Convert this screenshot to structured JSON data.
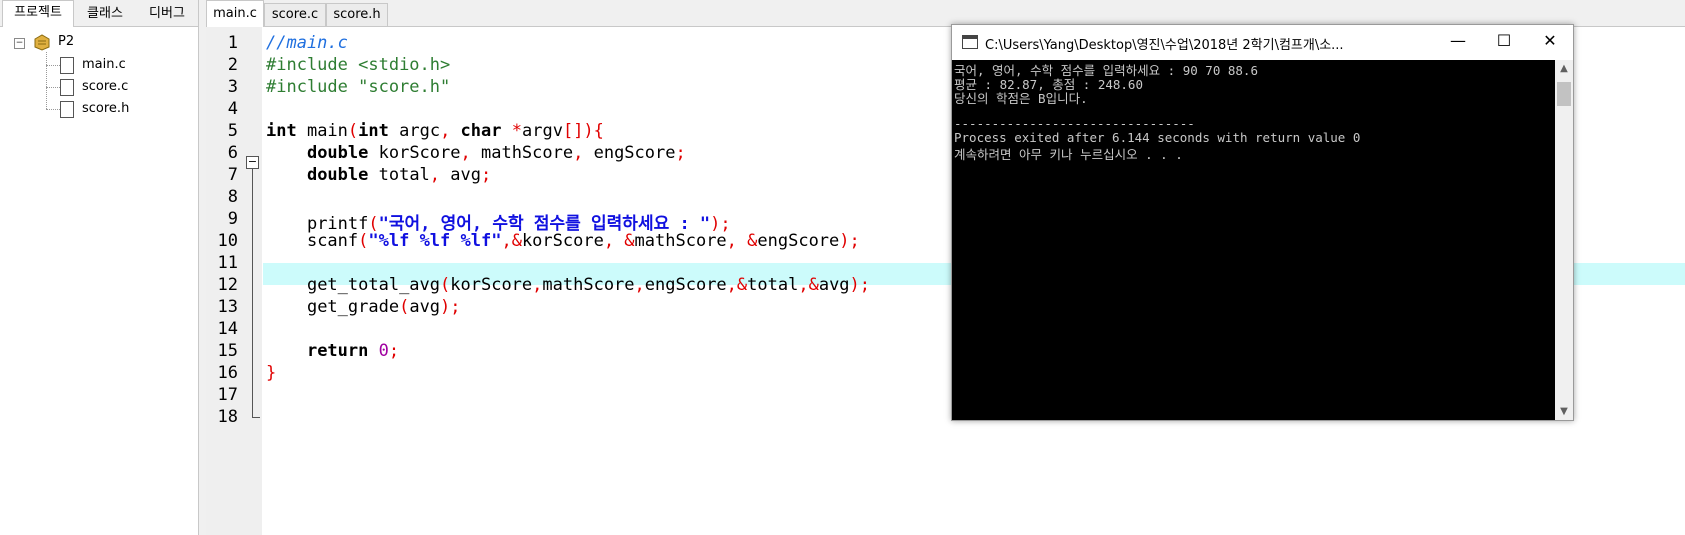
{
  "left_tabs": [
    "프로젝트",
    "클래스",
    "디버그"
  ],
  "project": {
    "name": "P2",
    "files": [
      "main.c",
      "score.c",
      "score.h"
    ]
  },
  "editor_tabs": [
    "main.c",
    "score.c",
    "score.h"
  ],
  "line_numbers": [
    "1",
    "2",
    "3",
    "4",
    "5",
    "6",
    "7",
    "8",
    "9",
    "10",
    "11",
    "12",
    "13",
    "14",
    "15",
    "16",
    "17",
    "18"
  ],
  "code": {
    "l1": "//main.c",
    "l2a": "#include ",
    "l2b": "<stdio.h>",
    "l3": "#include \"score.h\"",
    "l5_int": "int",
    "l5_main": " main",
    "l5_p1": "(",
    "l5_int2": "int",
    "l5_argc": " argc",
    "l5_c1": ",",
    "l5_char": " char",
    "l5_sp": " ",
    "l5_star": "*",
    "l5_argv": "argv",
    "l5_br": "[])",
    "l5_brace": "{",
    "l6_kw": "double",
    "l6_v1": " korScore",
    "l6_c1": ",",
    "l6_v2": " mathScore",
    "l6_c2": ",",
    "l6_v3": " engScore",
    "l6_sc": ";",
    "l7_kw": "double",
    "l7_v1": " total",
    "l7_c1": ",",
    "l7_v2": " avg",
    "l7_sc": ";",
    "l9_fn": "printf",
    "l9_p": "(",
    "l9_str": "\"국어, 영어, 수학 점수를 입력하세요 : \"",
    "l9_end": ");",
    "l10_fn": "scanf",
    "l10_p": "(",
    "l10_str": "\"%lf %lf %lf\"",
    "l10_c1": ",&",
    "l10_v1": "korScore",
    "l10_c2": ", &",
    "l10_v2": "mathScore",
    "l10_c3": ", &",
    "l10_v3": "engScore",
    "l10_end": ");",
    "l12_fn": "get_total_avg",
    "l12_p": "(",
    "l12_v1": "korScore",
    "l12_c1": ",",
    "l12_v2": "mathScore",
    "l12_c2": ",",
    "l12_v3": "engScore",
    "l12_c3": ",&",
    "l12_v4": "total",
    "l12_c4": ",&",
    "l12_v5": "avg",
    "l12_end": ");",
    "l13_fn": "get_grade",
    "l13_p": "(",
    "l13_v1": "avg",
    "l13_end": ");",
    "l15_kw": "return",
    "l15_sp": " ",
    "l15_num": "0",
    "l15_end": ";",
    "l16": "}"
  },
  "console": {
    "title": "C:\\Users\\Yang\\Desktop\\영진\\수업\\2018년 2학기\\컴프개\\소...",
    "lines": [
      "국어, 영어, 수학 점수를 입력하세요 : 90 70 88.6",
      "평균 : 82.87, 총점 : 248.60",
      "당신의 학점은 B입니다.",
      "",
      "--------------------------------",
      "Process exited after 6.144 seconds with return value 0",
      "계속하려면 아무 키나 누르십시오 . . ."
    ],
    "minimize": "—",
    "maximize": "☐",
    "close": "✕"
  }
}
